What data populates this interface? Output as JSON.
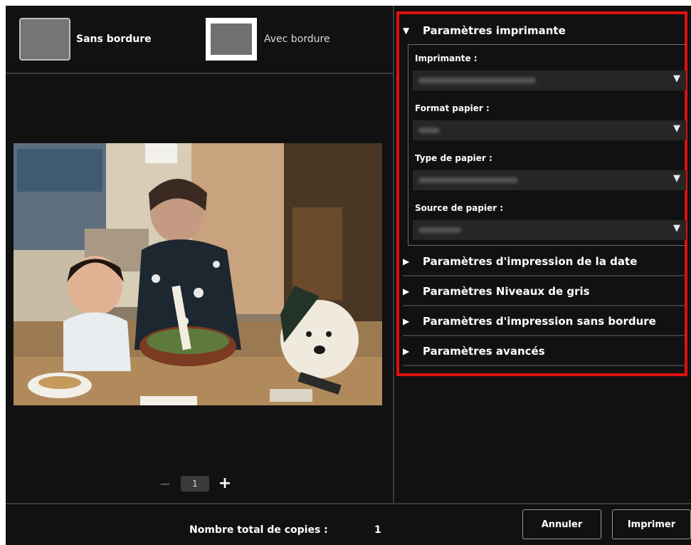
{
  "border_options": {
    "borderless_label": "Sans bordure",
    "bordered_label": "Avec bordure"
  },
  "copies": {
    "value": "1",
    "minus": "−",
    "plus": "+"
  },
  "printer_settings": {
    "title": "Paramètres imprimante",
    "fields": [
      {
        "label": "Imprimante :"
      },
      {
        "label": "Format papier :"
      },
      {
        "label": "Type de papier :"
      },
      {
        "label": "Source de papier :"
      }
    ]
  },
  "collapsed_sections": [
    "Paramètres d'impression de la date",
    "Paramètres Niveaux de gris",
    "Paramètres d'impression sans bordure",
    "Paramètres avancés"
  ],
  "footer": {
    "total_label": "Nombre total de copies :",
    "total_value": "1",
    "cancel_label": "Annuler",
    "print_label": "Imprimer"
  },
  "colors": {
    "background": "#111111",
    "highlight": "#e01010"
  },
  "icons": {
    "expanded": "triangle-down-icon",
    "collapsed": "triangle-right-icon",
    "dropdown": "dropdown-arrow-icon"
  }
}
